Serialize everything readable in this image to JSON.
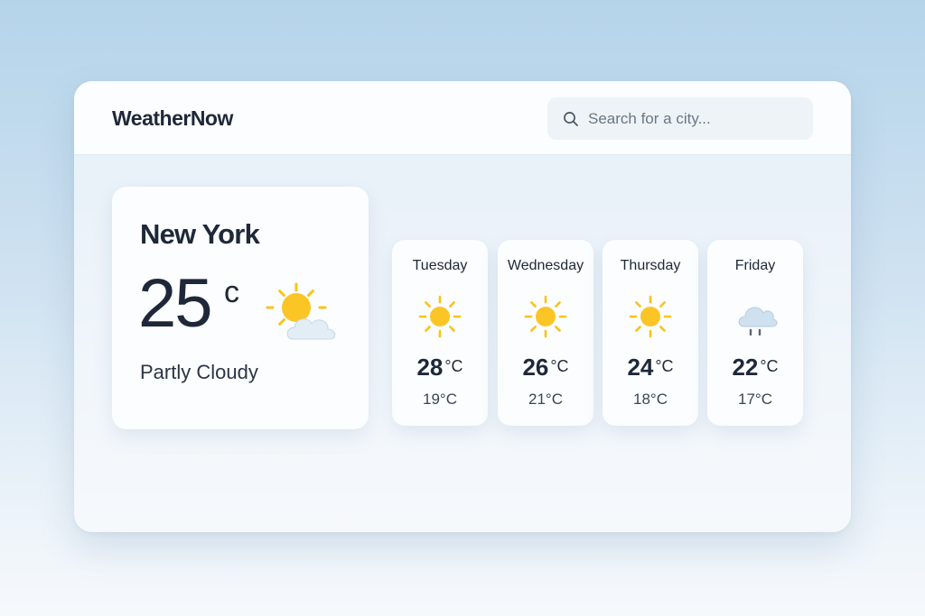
{
  "app": {
    "brand": "WeatherNow"
  },
  "search": {
    "placeholder": "Search for a city...",
    "value": ""
  },
  "current": {
    "city": "New York",
    "temperature": "25",
    "unit": "c",
    "condition": "Partly Cloudy",
    "icon": "partly-cloudy-icon"
  },
  "forecast": [
    {
      "day": "Tuesday",
      "high": "28",
      "high_unit": "°C",
      "low": "19°C",
      "icon": "sun-icon"
    },
    {
      "day": "Wednesday",
      "high": "26",
      "high_unit": "°C",
      "low": "21°C",
      "icon": "sun-icon"
    },
    {
      "day": "Thursday",
      "high": "24",
      "high_unit": "°C",
      "low": "18°C",
      "icon": "sun-icon"
    },
    {
      "day": "Friday",
      "high": "22",
      "high_unit": "°C",
      "low": "17°C",
      "icon": "rain-cloud-icon"
    }
  ],
  "colors": {
    "sun": "#f9c31c",
    "cloud": "#dce9f3",
    "text": "#1e2838",
    "card": "#fbfdfe"
  }
}
